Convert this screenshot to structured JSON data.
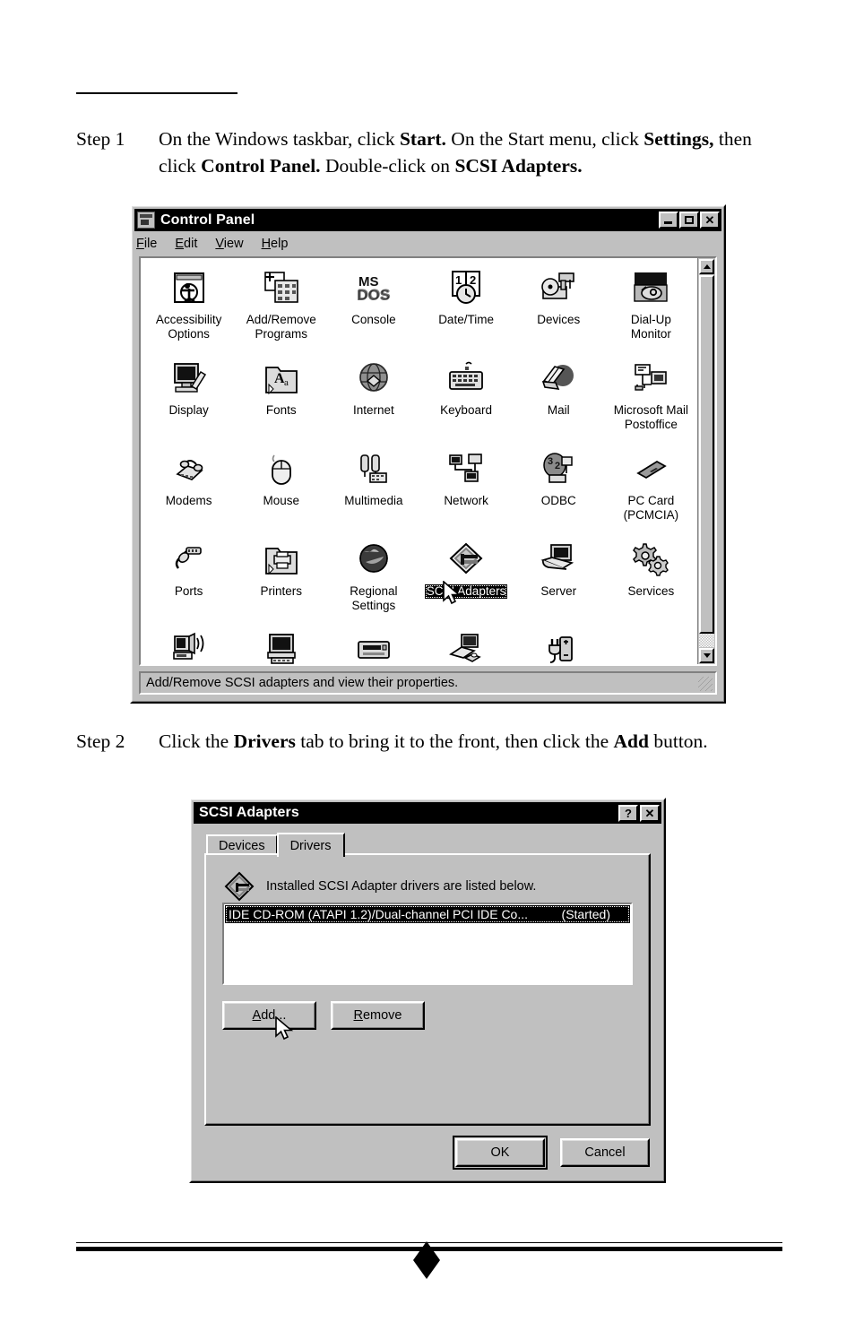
{
  "page": {
    "step1": {
      "label": "Step 1",
      "parts": [
        {
          "t": "On the Windows taskbar, click ",
          "b": false
        },
        {
          "t": "Start.",
          "b": true
        },
        {
          "t": " On the Start menu, click ",
          "b": false
        },
        {
          "t": "Settings,",
          "b": true
        },
        {
          "t": " then click ",
          "b": false
        },
        {
          "t": "Control Panel.",
          "b": true
        },
        {
          "t": " Double-click on ",
          "b": false
        },
        {
          "t": "SCSI Adapters.",
          "b": true
        }
      ]
    },
    "step2": {
      "label": "Step 2",
      "parts": [
        {
          "t": "Click the ",
          "b": false
        },
        {
          "t": "Drivers",
          "b": true
        },
        {
          "t": " tab to bring it to the front, then click the ",
          "b": false
        },
        {
          "t": "Add",
          "b": true
        },
        {
          "t": " button.",
          "b": false
        }
      ]
    }
  },
  "control_panel": {
    "title": "Control Panel",
    "title_icon": "control-panel-icon",
    "window_buttons": [
      {
        "name": "minimize-button",
        "glyph": "_"
      },
      {
        "name": "maximize-button",
        "glyph": "□"
      },
      {
        "name": "close-button",
        "glyph": "✕"
      }
    ],
    "menus": [
      {
        "label": "File",
        "accel": "F"
      },
      {
        "label": "Edit",
        "accel": "E"
      },
      {
        "label": "View",
        "accel": "V"
      },
      {
        "label": "Help",
        "accel": "H"
      }
    ],
    "items": [
      {
        "label": "Accessibility\nOptions",
        "icon": "accessibility-icon",
        "selected": false
      },
      {
        "label": "Add/Remove\nPrograms",
        "icon": "add-remove-programs-icon",
        "selected": false
      },
      {
        "label": "Console",
        "icon": "ms-dos-console-icon",
        "selected": false
      },
      {
        "label": "Date/Time",
        "icon": "date-time-icon",
        "selected": false
      },
      {
        "label": "Devices",
        "icon": "devices-icon",
        "selected": false
      },
      {
        "label": "Dial-Up\nMonitor",
        "icon": "dial-up-monitor-icon",
        "selected": false
      },
      {
        "label": "Display",
        "icon": "display-icon",
        "selected": false
      },
      {
        "label": "Fonts",
        "icon": "fonts-folder-icon",
        "selected": false
      },
      {
        "label": "Internet",
        "icon": "internet-globe-icon",
        "selected": false
      },
      {
        "label": "Keyboard",
        "icon": "keyboard-icon",
        "selected": false
      },
      {
        "label": "Mail",
        "icon": "mail-icon",
        "selected": false
      },
      {
        "label": "Microsoft Mail\nPostoffice",
        "icon": "microsoft-mail-postoffice-icon",
        "selected": false
      },
      {
        "label": "Modems",
        "icon": "modems-icon",
        "selected": false
      },
      {
        "label": "Mouse",
        "icon": "mouse-icon",
        "selected": false
      },
      {
        "label": "Multimedia",
        "icon": "multimedia-icon",
        "selected": false
      },
      {
        "label": "Network",
        "icon": "network-icon",
        "selected": false
      },
      {
        "label": "ODBC",
        "icon": "odbc-icon",
        "selected": false
      },
      {
        "label": "PC Card\n(PCMCIA)",
        "icon": "pc-card-icon",
        "selected": false
      },
      {
        "label": "Ports",
        "icon": "ports-icon",
        "selected": false
      },
      {
        "label": "Printers",
        "icon": "printers-folder-icon",
        "selected": false
      },
      {
        "label": "Regional\nSettings",
        "icon": "regional-settings-globe-icon",
        "selected": false
      },
      {
        "label": "SCSI Adapters",
        "icon": "scsi-adapters-icon",
        "selected": true
      },
      {
        "label": "Server",
        "icon": "server-icon",
        "selected": false
      },
      {
        "label": "Services",
        "icon": "services-gears-icon",
        "selected": false
      },
      {
        "label": "",
        "icon": "sounds-icon",
        "selected": false
      },
      {
        "label": "",
        "icon": "system-icon",
        "selected": false
      },
      {
        "label": "",
        "icon": "tape-devices-icon",
        "selected": false
      },
      {
        "label": "",
        "icon": "telephony-icon",
        "selected": false
      },
      {
        "label": "",
        "icon": "ups-icon",
        "selected": false
      }
    ],
    "statusbar": "Add/Remove SCSI adapters and view their properties."
  },
  "scsi_dialog": {
    "title": "SCSI Adapters",
    "window_buttons": [
      {
        "name": "help-button",
        "glyph": "?"
      },
      {
        "name": "close-button",
        "glyph": "✕"
      }
    ],
    "tabs": [
      {
        "label": "Devices",
        "active": false
      },
      {
        "label": "Drivers",
        "active": true
      }
    ],
    "hint": "Installed SCSI Adapter drivers are listed below.",
    "hint_icon": "scsi-adapters-icon",
    "drivers": [
      {
        "name": "IDE CD-ROM (ATAPI 1.2)/Dual-channel PCI IDE Co...",
        "status": "(Started)",
        "selected": true
      }
    ],
    "buttons": {
      "add": {
        "label": "Add...",
        "accel": "A"
      },
      "remove": {
        "label": "Remove",
        "accel": "R"
      },
      "ok": {
        "label": "OK",
        "default": true
      },
      "cancel": {
        "label": "Cancel",
        "default": false
      }
    }
  },
  "colors": {
    "window_face": "#c0c0c0",
    "titlebar": "#000000",
    "titlebar_text": "#ffffff",
    "selection": "#000000",
    "page_bg": "#ffffff"
  }
}
